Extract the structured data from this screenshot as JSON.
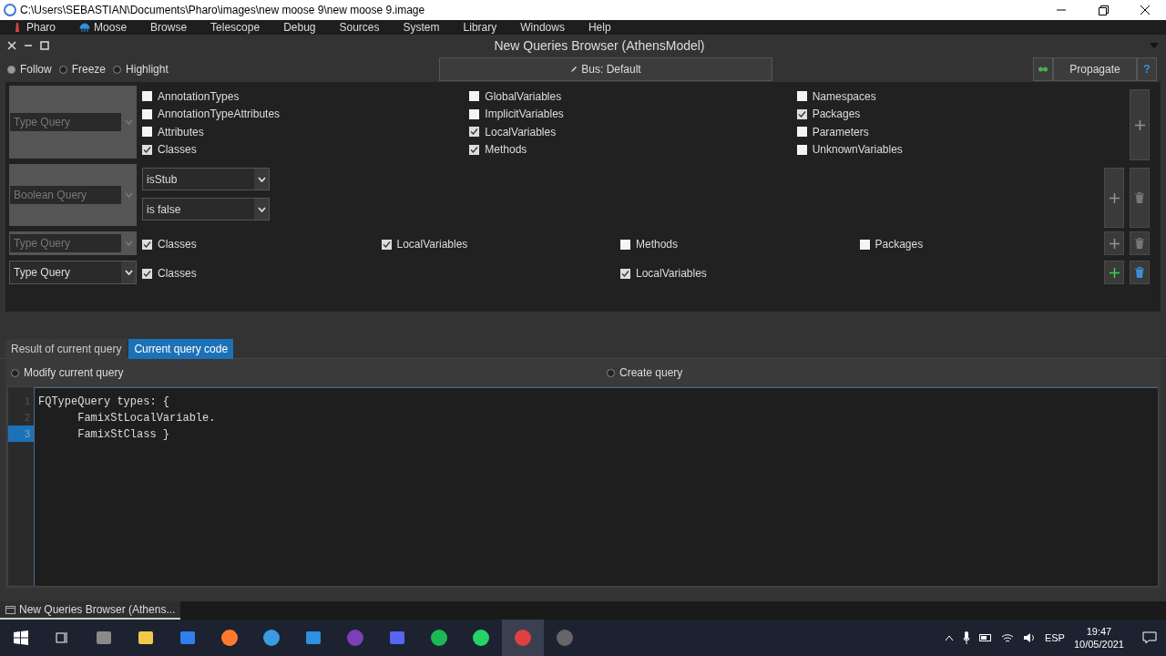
{
  "os_window": {
    "title": "C:\\Users\\SEBASTIAN\\Documents\\Pharo\\images\\new moose 9\\new moose 9.image"
  },
  "menu_bar": [
    "Pharo",
    "Moose",
    "Browse",
    "Telescope",
    "Debug",
    "Sources",
    "System",
    "Library",
    "Windows",
    "Help"
  ],
  "window": {
    "title": "New Queries Browser (AthensModel)"
  },
  "modes": [
    {
      "label": "Follow",
      "selected": true
    },
    {
      "label": "Freeze",
      "selected": false
    },
    {
      "label": "Highlight",
      "selected": false
    }
  ],
  "bus_button": "Bus: Default",
  "propagate_button": "Propagate",
  "help_button": "?",
  "queries": [
    {
      "kind": "type",
      "query": "Type Query",
      "disabled": true,
      "removable": false,
      "columns": [
        [
          {
            "label": "AnnotationTypes",
            "checked": false
          },
          {
            "label": "AnnotationTypeAttributes",
            "checked": false
          },
          {
            "label": "Attributes",
            "checked": false
          },
          {
            "label": "Classes",
            "checked": true
          }
        ],
        [
          {
            "label": "GlobalVariables",
            "checked": false
          },
          {
            "label": "ImplicitVariables",
            "checked": false
          },
          {
            "label": "LocalVariables",
            "checked": true
          },
          {
            "label": "Methods",
            "checked": true
          }
        ],
        [
          {
            "label": "Namespaces",
            "checked": false
          },
          {
            "label": "Packages",
            "checked": true
          },
          {
            "label": "Parameters",
            "checked": false
          },
          {
            "label": "UnknownVariables",
            "checked": false
          }
        ]
      ]
    },
    {
      "kind": "boolean",
      "query": "Boolean Query",
      "disabled": true,
      "removable": true,
      "property": "isStub",
      "condition": "is false"
    },
    {
      "kind": "type",
      "query": "Type Query",
      "disabled": true,
      "removable": true,
      "columns": [
        [
          {
            "label": "Classes",
            "checked": true
          }
        ],
        [
          {
            "label": "LocalVariables",
            "checked": true
          }
        ],
        [
          {
            "label": "Methods",
            "checked": false
          }
        ],
        [
          {
            "label": "Packages",
            "checked": false
          }
        ]
      ]
    },
    {
      "kind": "type",
      "query": "Type Query",
      "disabled": false,
      "removable": true,
      "columns": [
        [
          {
            "label": "Classes",
            "checked": true
          }
        ],
        [
          {
            "label": "LocalVariables",
            "checked": true
          }
        ]
      ]
    }
  ],
  "tabs": [
    {
      "label": "Result of current query",
      "selected": false
    },
    {
      "label": "Current query code",
      "selected": true
    }
  ],
  "actions": [
    {
      "label": "Modify current query",
      "selected": false
    },
    {
      "label": "Create query",
      "selected": false
    }
  ],
  "code": [
    {
      "number": "1",
      "text": "FQTypeQuery types: {",
      "current": false
    },
    {
      "number": "2",
      "text": "\tFamixStLocalVariable.",
      "current": false
    },
    {
      "number": "3",
      "text": "\tFamixStClass }",
      "current": true
    }
  ],
  "pharo_taskbar": [
    "New Queries Browser (Athens..."
  ],
  "tray": {
    "language": "ESP",
    "time": "19:47",
    "date": "10/05/2021"
  }
}
